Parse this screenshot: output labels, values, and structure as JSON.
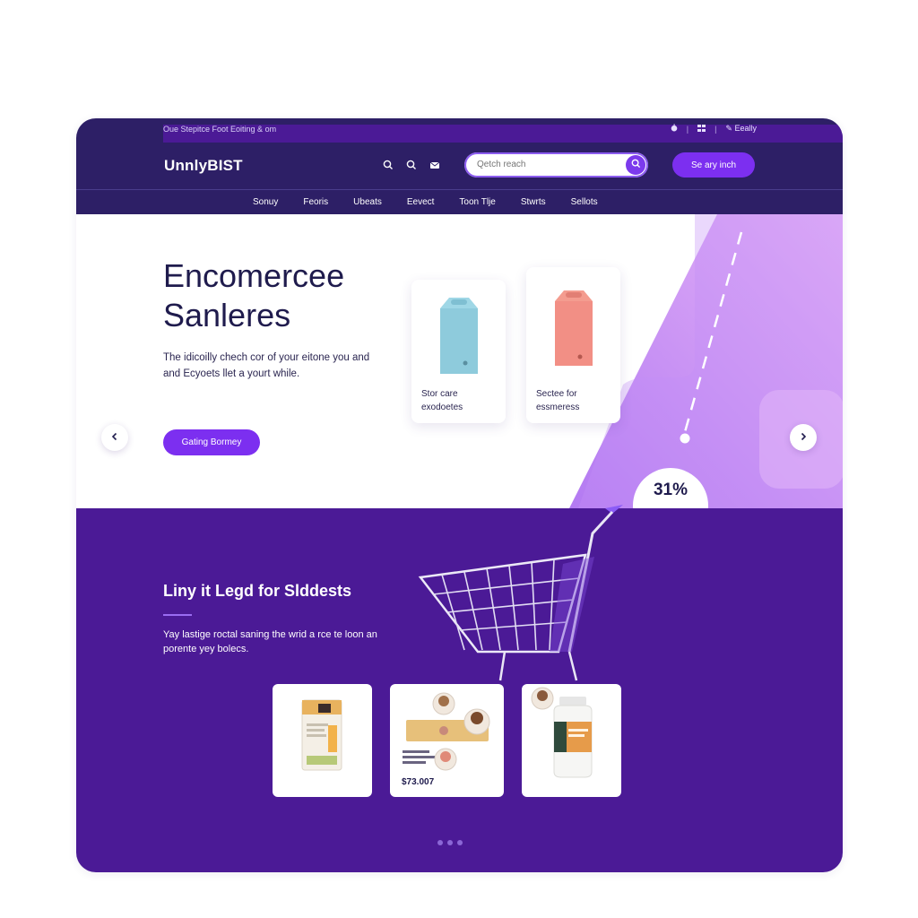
{
  "topbar": {
    "promo_text": "Oue Stepitce Foot Eoiting & om",
    "right_text": "Eeally"
  },
  "header": {
    "logo": "UnnlyBIST",
    "search_placeholder": "Qetch reach",
    "cta_label": "Se ary inch"
  },
  "nav": {
    "items": [
      "Sonuy",
      "Feoris",
      "Ubeats",
      "Eevect",
      "Toon Tlje",
      "Stwrts",
      "Sellots"
    ]
  },
  "hero": {
    "title_line1": "Encomercee",
    "title_line2": "Sanleres",
    "description": "The idicoilly chech cor of your eitone you and and Ecyoets llet a yourt while.",
    "button_label": "Gating Bormey",
    "cards": [
      {
        "label_line1": "Stor care",
        "label_line2": "exodoetes",
        "box_color": "#9fd7e6"
      },
      {
        "label_line1": "Sectee for",
        "label_line2": "essmeress",
        "box_color": "#f49c8f"
      }
    ],
    "percent": "31%"
  },
  "promo": {
    "title": "Liny it Legd for Slddests",
    "description": "Yay lastige roctal saning the wrid a rce te loon an porente yey bolecs.",
    "price": "$73.007"
  },
  "colors": {
    "nav_bg": "#2d1f66",
    "accent": "#7c2ff0",
    "promo_bg": "#4b1a96",
    "lilac": "#c99af5"
  }
}
